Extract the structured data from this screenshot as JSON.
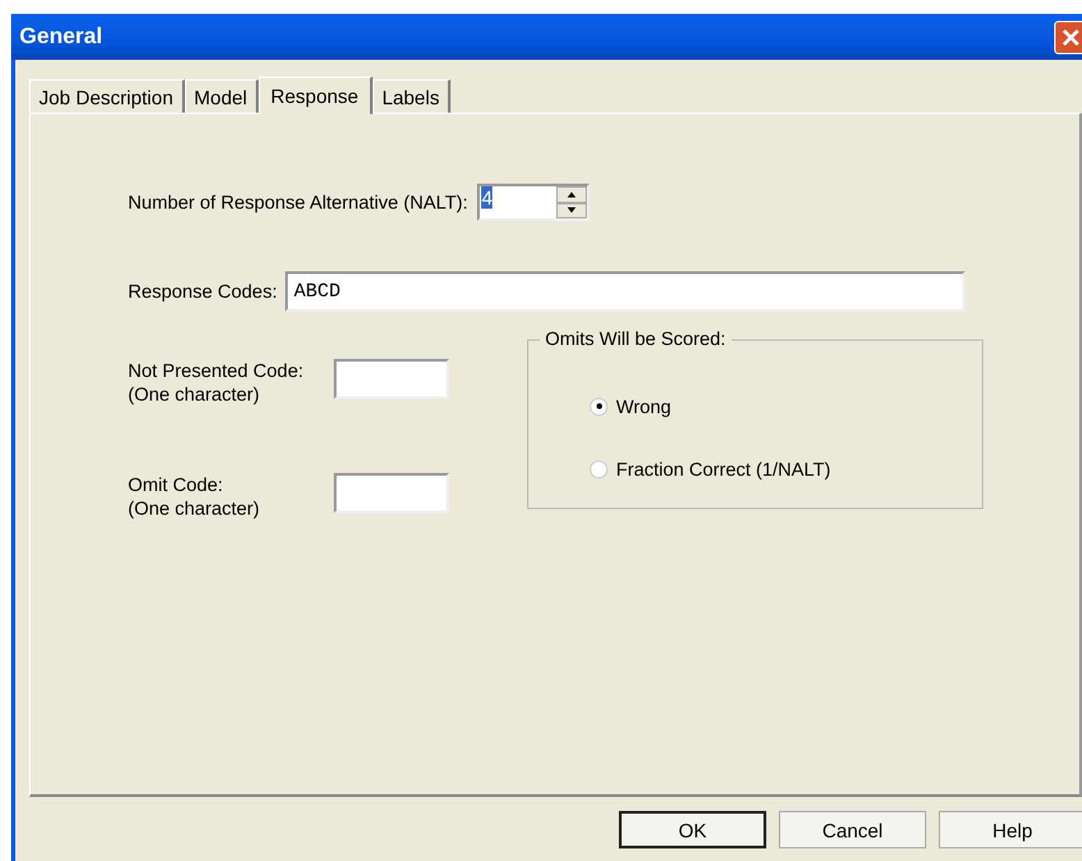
{
  "window": {
    "title": "General"
  },
  "tabs": [
    {
      "label": "Job Description",
      "selected": false
    },
    {
      "label": "Model",
      "selected": false
    },
    {
      "label": "Response",
      "selected": true
    },
    {
      "label": "Labels",
      "selected": false
    }
  ],
  "nalt": {
    "label": "Number of Response Alternative (NALT):",
    "value": "4"
  },
  "response_codes": {
    "label": "Response Codes:",
    "value": "ABCD"
  },
  "not_presented_code": {
    "label": "Not Presented Code:",
    "hint": "(One character)"
  },
  "omit_code": {
    "label": "Omit Code:",
    "hint": "(One character)"
  },
  "omits_group": {
    "title": "Omits Will be Scored:",
    "options": [
      {
        "label": "Wrong",
        "selected": true
      },
      {
        "label": "Fraction Correct (1/NALT)",
        "selected": false
      }
    ]
  },
  "buttons": [
    {
      "label": "OK",
      "default": true
    },
    {
      "label": "Cancel",
      "default": false
    },
    {
      "label": "Help",
      "default": false
    }
  ]
}
